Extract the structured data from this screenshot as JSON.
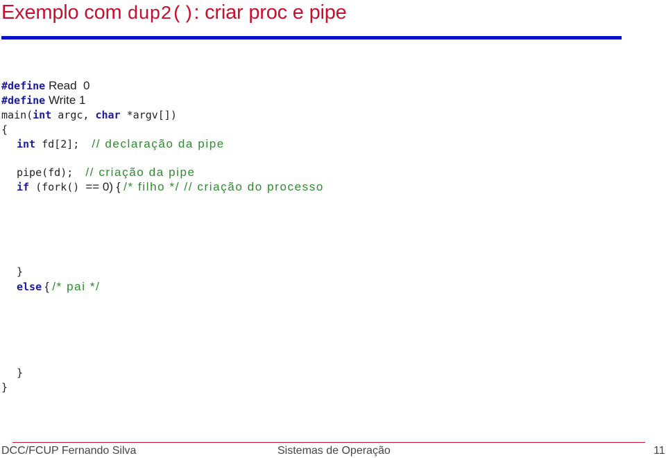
{
  "slide": {
    "title_prefix": "Exemplo com ",
    "title_code": "dup2()",
    "title_suffix": ": criar proc e pipe",
    "colors": {
      "title": "#c8102e",
      "rule": "#0a10c8",
      "keyword": "#1a1aa0",
      "comment": "#2e8b2e"
    }
  },
  "code": {
    "l1_kw": "#define",
    "l1_rest": " Read  0",
    "l2_kw": "#define",
    "l2_rest": " Write 1",
    "l3_a": "main(",
    "l3_kw1": "int",
    "l3_b": " argc, ",
    "l3_kw2": "char",
    "l3_c": " *argv[])",
    "l4": "{",
    "l5_kw": "int",
    "l5_a": " fd[2];  ",
    "l5_cm": "// declaração da pipe",
    "l6_a": "pipe(fd);  ",
    "l6_cm": "// criação da pipe",
    "l7_kw": "if",
    "l7_a": " (fork() ",
    "l7_b": "== 0) { ",
    "l7_cm": "/* filho */ // criação do processo",
    "l8": "}",
    "l9_kw": "else",
    "l9_a": " { ",
    "l9_cm": "/* pai */",
    "l10": "}",
    "l11": "}"
  },
  "footer": {
    "left": "DCC/FCUP Fernando Silva",
    "center": "Sistemas de Operação",
    "page": "11"
  }
}
